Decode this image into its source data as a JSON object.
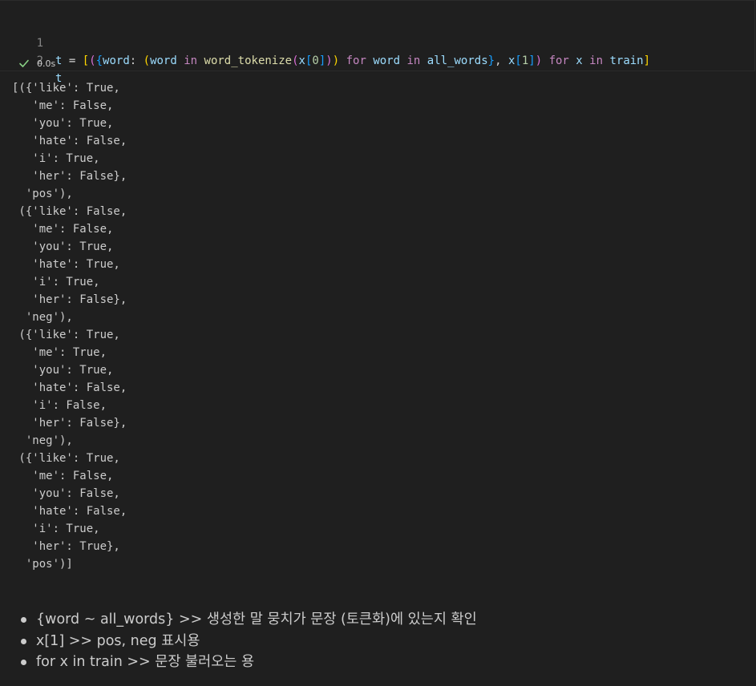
{
  "cell": {
    "line_numbers": [
      "1",
      "2"
    ],
    "line1": {
      "t": "t",
      "eq": " = ",
      "lb": "[",
      "lp": "(",
      "lc": "{",
      "word": "word",
      "colon": ": ",
      "lp2": "(",
      "word2": "word",
      "sp1": " ",
      "in1": "in",
      "sp2": " ",
      "func": "word_tokenize",
      "lp3": "(",
      "x1": "x",
      "lb2": "[",
      "zero": "0",
      "rb2": "]",
      "rp3": ")",
      "rp2": ")",
      "sp3": " ",
      "for1": "for",
      "sp4": " ",
      "word3": "word",
      "sp5": " ",
      "in2": "in",
      "sp6": " ",
      "allw": "all_words",
      "rc": "}",
      "comma": ", ",
      "x2": "x",
      "lb3": "[",
      "one": "1",
      "rb3": "]",
      "rp": ")",
      "sp7": " ",
      "for2": "for",
      "sp8": " ",
      "x3": "x",
      "sp9": " ",
      "in3": "in",
      "sp10": " ",
      "train": "train",
      "rb": "]"
    },
    "line2": "t",
    "status": "0.0s"
  },
  "output": "[({'like': True,\n   'me': False,\n   'you': True,\n   'hate': False,\n   'i': True,\n   'her': False},\n  'pos'),\n ({'like': False,\n   'me': False,\n   'you': True,\n   'hate': True,\n   'i': True,\n   'her': False},\n  'neg'),\n ({'like': True,\n   'me': True,\n   'you': True,\n   'hate': False,\n   'i': False,\n   'her': False},\n  'neg'),\n ({'like': True,\n   'me': False,\n   'you': False,\n   'hate': False,\n   'i': True,\n   'her': True},\n  'pos')]",
  "markdown": {
    "items": [
      "{word ~ all_words} >> 생성한 말 뭉치가 문장 (토큰화)에 있는지 확인",
      "x[1] >> pos, neg 표시용",
      "for x in train >> 문장 불러오는 용"
    ]
  },
  "colors": {
    "background": "#1f1f1f",
    "success_check": "#89d185",
    "keyword": "#c586c0",
    "variable": "#9cdcfe",
    "function": "#dcdcaa",
    "number": "#b5cea8"
  }
}
